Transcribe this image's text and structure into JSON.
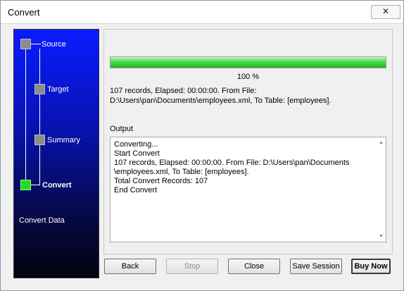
{
  "window": {
    "title": "Convert",
    "close_glyph": "✕"
  },
  "wizard": {
    "steps": [
      {
        "label": "Source",
        "state": "pending"
      },
      {
        "label": "Target",
        "state": "pending"
      },
      {
        "label": "Summary",
        "state": "pending"
      },
      {
        "label": "Convert",
        "state": "active"
      }
    ],
    "footer_label": "Convert Data",
    "colors": {
      "step_pending": "#8c8c8c",
      "step_active": "#22dd22",
      "panel_top": "#0a1cff",
      "panel_bottom": "#02030f"
    }
  },
  "progress": {
    "value_percent": 100,
    "label": "100 %",
    "status_line1": "107 records,    Elapsed: 00:00:00.    From File:",
    "status_line2": "D:\\Users\\pan\\Documents\\employees.xml,    To Table: [employees]."
  },
  "output": {
    "label": "Output",
    "lines": [
      "Converting...",
      "Start Convert",
      "107 records,    Elapsed: 00:00:00.    From File: D:\\Users\\pan\\Documents",
      "\\employees.xml,    To Table: [employees].",
      "Total Convert Records: 107",
      "End Convert"
    ],
    "scroll_up_glyph": "▲",
    "scroll_down_glyph": "▼"
  },
  "buttons": {
    "back": "Back",
    "stop": "Stop",
    "close": "Close",
    "save_session": "Save Session",
    "buy_now": "Buy Now"
  }
}
